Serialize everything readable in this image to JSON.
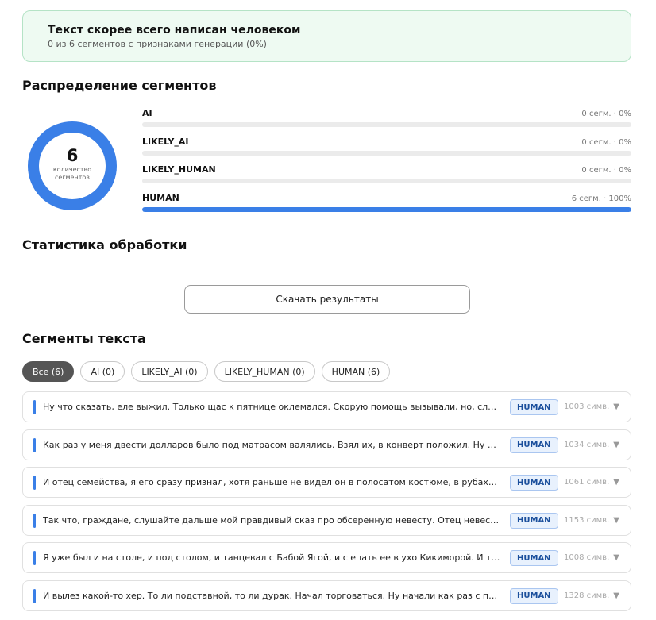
{
  "verdict": {
    "title": "Текст скорее всего написан человеком",
    "subtitle": "0 из 6 сегментов с признаками генерации (0%)"
  },
  "distribution": {
    "title": "Распределение сегментов",
    "donut": {
      "total": "6",
      "label": "количество сегментов",
      "color": "#3a7fe7",
      "human_fraction": 1.0
    },
    "bars": [
      {
        "name": "AI",
        "value": "0 сегм. · 0%",
        "fraction": 0
      },
      {
        "name": "LIKELY_AI",
        "value": "0 сегм. · 0%",
        "fraction": 0
      },
      {
        "name": "LIKELY_HUMAN",
        "value": "0 сегм. · 0%",
        "fraction": 0
      },
      {
        "name": "HUMAN",
        "value": "6 сегм. · 100%",
        "fraction": 1.0
      }
    ]
  },
  "stats": {
    "title": "Статистика обработки",
    "download_label": "Скачать результаты"
  },
  "segments": {
    "title": "Сегменты текста",
    "filters": [
      {
        "label": "Все (6)",
        "active": true
      },
      {
        "label": "AI (0)",
        "active": false
      },
      {
        "label": "LIKELY_AI (0)",
        "active": false
      },
      {
        "label": "LIKELY_HUMAN (0)",
        "active": false
      },
      {
        "label": "HUMAN (6)",
        "active": false
      }
    ],
    "items": [
      {
        "text": "Ну что сказать, еле выжил. Только щас к пятнице оклемался. Скорую помощь вызывали, но, слава бога...",
        "badge": "HUMAN",
        "chars": "1003 симв."
      },
      {
        "text": "Как раз у меня двести долларов было под матрасом валялись. Взял их, в конверт положил. Ну и готов, ...",
        "badge": "HUMAN",
        "chars": "1034 симв."
      },
      {
        "text": "И отец семейства, я его сразу признал, хотя раньше не видел он в полосатом костюме, в рубахе, в галс...",
        "badge": "HUMAN",
        "chars": "1061 симв."
      },
      {
        "text": "Так что, граждане, слушайте дальше мой правдивый сказ про обсеренную невесту. Отец невесты мне ...",
        "badge": "HUMAN",
        "chars": "1153 симв."
      },
      {
        "text": "Я уже был и на столе, и под столом, и танцевал с Бабой Ягой, и с епать ее в ухо Кикиморой. И так пот...",
        "badge": "HUMAN",
        "chars": "1008 симв."
      },
      {
        "text": "И вылез какой-то хер. То ли подставной, то ли дурак. Начал торговаться. Ну начали как раз с пяти тыщ...",
        "badge": "HUMAN",
        "chars": "1328 симв."
      }
    ],
    "chevron": "▼"
  }
}
